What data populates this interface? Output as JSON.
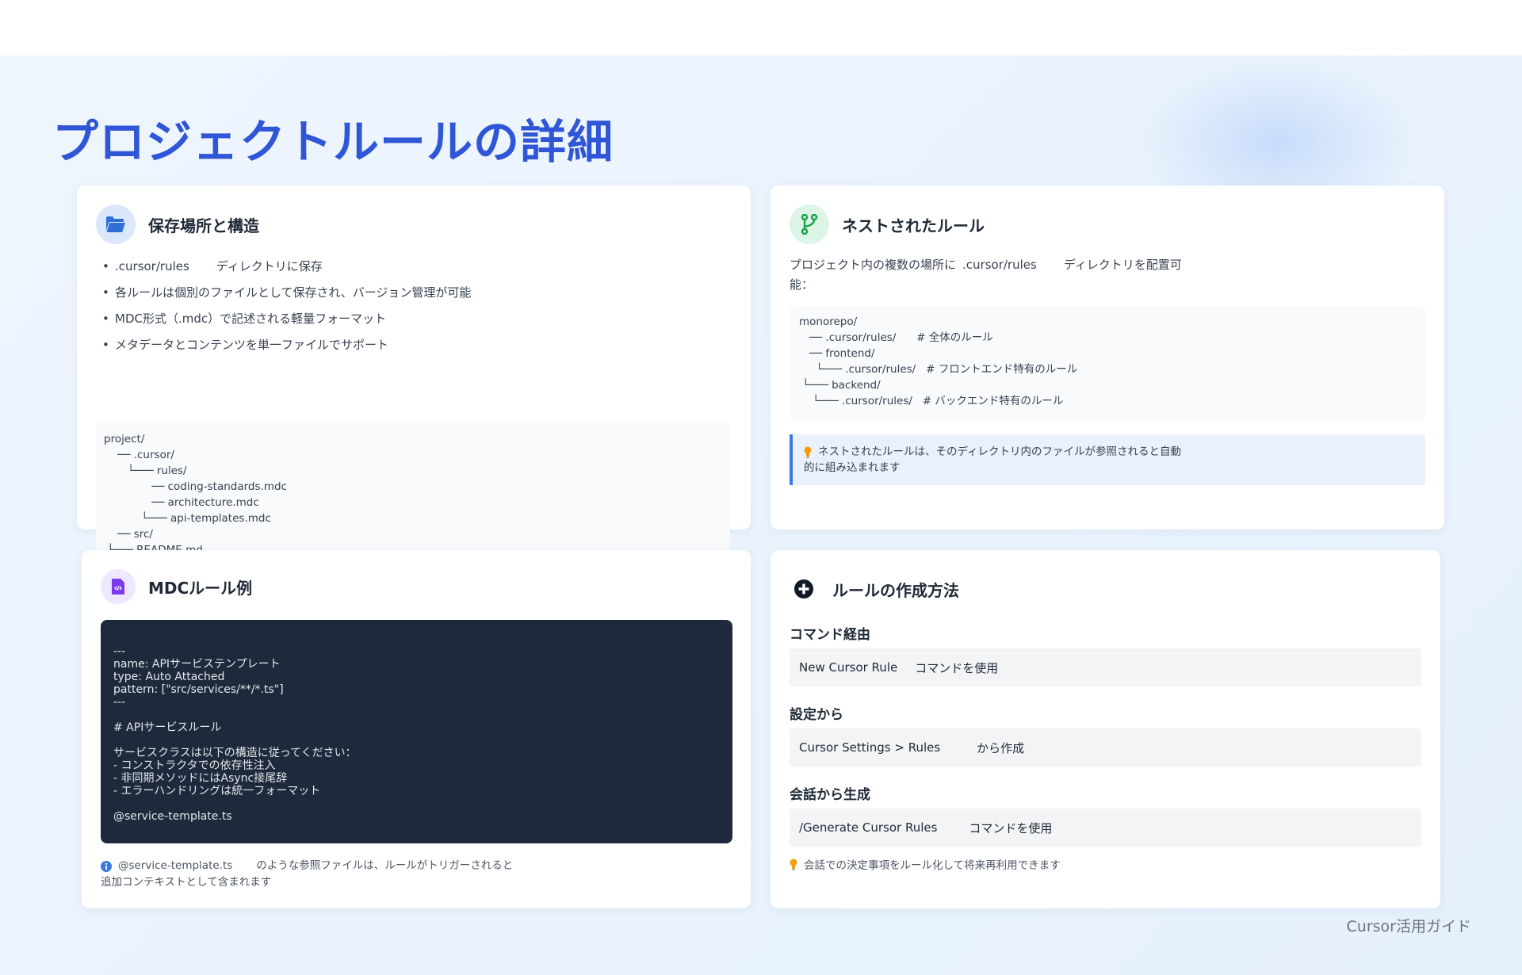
{
  "page_title": "プロジェクトルールの詳細",
  "footer": "Cursor活用ガイド",
  "icons": {
    "storage": "folder-open-icon",
    "nested": "code-branch-icon",
    "mdc": "code-file-icon",
    "create": "plus-circle-icon",
    "bulb": "lightbulb-icon",
    "info": "info-circle-icon"
  },
  "colors": {
    "title": "#2f56d6",
    "accent_blue": "#3b7be0",
    "accent_green": "#16a34a",
    "accent_purple": "#7c3aed",
    "code_bg": "#1e293b",
    "bulb": "#f59e0b"
  },
  "storage": {
    "title": "保存場所と構造",
    "bullet1_code": ".cursor/rules",
    "bullet1_text": "ディレクトリに保存",
    "bullet2": "各ルールは個別のファイルとして保存され、バージョン管理が可能",
    "bullet3": "MDC形式（.mdc）で記述される軽量フォーマット",
    "bullet4": "メタデータとコンテンツを単一ファイルでサポート",
    "tree": [
      "project/",
      "    ── .cursor/",
      "       └─── rules/",
      "              ── coding-standards.mdc",
      "              ── architecture.mdc",
      "           └─── api-templates.mdc",
      "    ── src/",
      " └─── README.md"
    ]
  },
  "nested": {
    "title": "ネストされたルール",
    "desc_prefix": "プロジェクト内の複数の場所に",
    "desc_code": ".cursor/rules",
    "desc_suffix": "ディレクトリを配置可",
    "desc_line2": "能：",
    "tree": [
      "monorepo/",
      "   ── .cursor/rules/      # 全体のルール",
      "   ── frontend/",
      "     └─── .cursor/rules/   # フロントエンド特有のルール",
      " └─── backend/",
      "    └─── .cursor/rules/   # バックエンド特有のルール"
    ],
    "note_line1": "ネストされたルールは、そのディレクトリ内のファイルが参照されると自動",
    "note_line2": "的に組み込まれます"
  },
  "mdc": {
    "title": "MDCルール例",
    "code": "---\nname: APIサービステンプレート\ntype: Auto Attached\npattern: [\"src/services/**/*.ts\"]\n---\n\n# APIサービスルール\n\nサービスクラスは以下の構造に従ってください：\n- コンストラクタでの依存性注入\n- 非同期メソッドにはAsync接尾辞\n- エラーハンドリングは統一フォーマット\n\n@service-template.ts",
    "info_code": "@service-template.ts",
    "info_text": "のような参照ファイルは、ルールがトリガーされると",
    "info_line2": "追加コンテキストとして含まれます"
  },
  "create": {
    "title": "ルールの作成方法",
    "methods": [
      {
        "heading": "コマンド経由",
        "cmd": "New Cursor Rule",
        "text": "コマンドを使用"
      },
      {
        "heading": "設定から",
        "cmd": "Cursor Settings > Rules",
        "text": "から作成"
      },
      {
        "heading": "会話から生成",
        "cmd": "/Generate Cursor Rules",
        "text": "コマンドを使用"
      }
    ],
    "tip": "会話での決定事項をルール化して将来再利用できます"
  }
}
